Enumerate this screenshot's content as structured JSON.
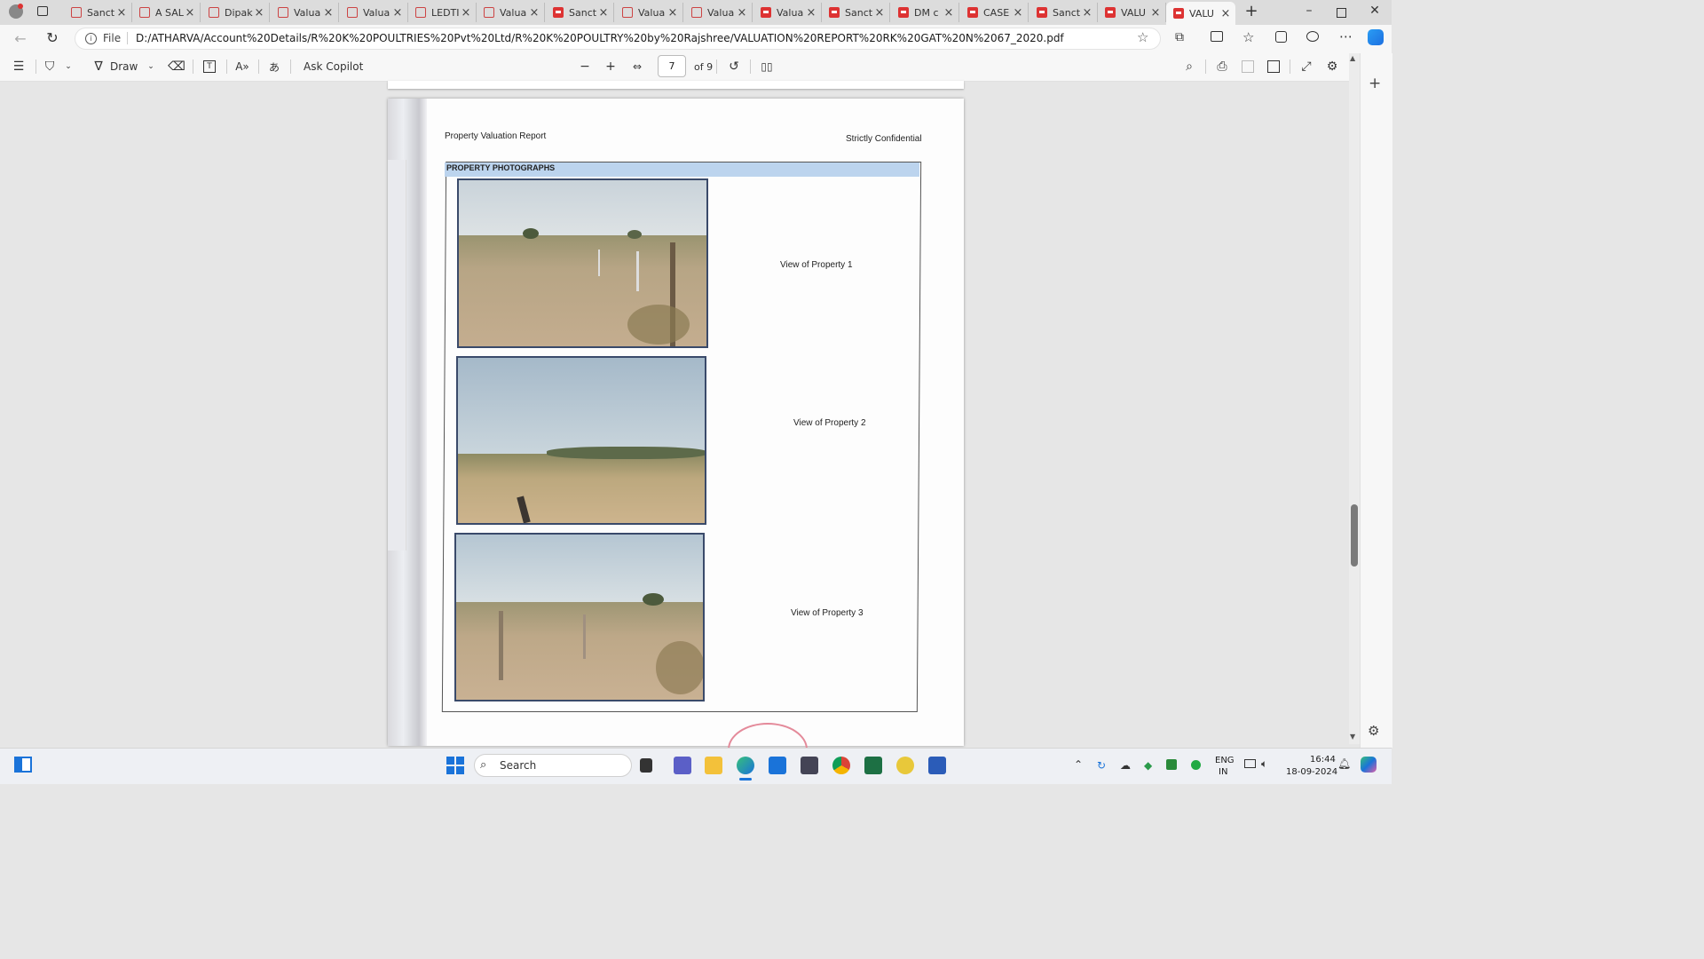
{
  "tabs": [
    {
      "label": "Sancti",
      "red": false
    },
    {
      "label": "A SAL",
      "red": false
    },
    {
      "label": "Dipak",
      "red": false
    },
    {
      "label": "Valua",
      "red": false
    },
    {
      "label": "Valua",
      "red": false
    },
    {
      "label": "LEDTI",
      "red": false
    },
    {
      "label": "Valua",
      "red": false
    },
    {
      "label": "Sancti",
      "red": true
    },
    {
      "label": "Valua",
      "red": false
    },
    {
      "label": "Valua",
      "red": false
    },
    {
      "label": "Valua",
      "red": true
    },
    {
      "label": "Sancti",
      "red": true
    },
    {
      "label": "DM c",
      "red": true
    },
    {
      "label": "CASE",
      "red": true
    },
    {
      "label": "Sancti",
      "red": true
    },
    {
      "label": "VALU",
      "red": true
    },
    {
      "label": "VALU",
      "red": true,
      "active": true
    }
  ],
  "address": {
    "scheme_label": "File",
    "url": "D:/ATHARVA/Account%20Details/R%20K%20POULTRIES%20Pvt%20Ltd/R%20K%20POULTRY%20by%20Rajshree/VALUATION%20REPORT%20RK%20GAT%20N%2067_2020.pdf"
  },
  "pdf_toolbar": {
    "draw_label": "Draw",
    "copilot_label": "Ask Copilot",
    "current_page": "7",
    "page_total": "of 9"
  },
  "document": {
    "header_left": "Property Valuation Report",
    "header_right": "Strictly Confidential",
    "section_title": "PROPERTY PHOTOGRAPHS",
    "photos": [
      {
        "caption": "View of Property 1"
      },
      {
        "caption": "View of Property 2"
      },
      {
        "caption": "View of Property 3"
      }
    ]
  },
  "taskbar": {
    "search_placeholder": "Search",
    "lang_top": "ENG",
    "lang_bottom": "IN",
    "time": "16:44",
    "date": "18-09-2024"
  },
  "colors": {
    "accent": "#0067c0",
    "section_header_bg": "#bcd4ee",
    "pdf_icon_red": "#d33333"
  }
}
